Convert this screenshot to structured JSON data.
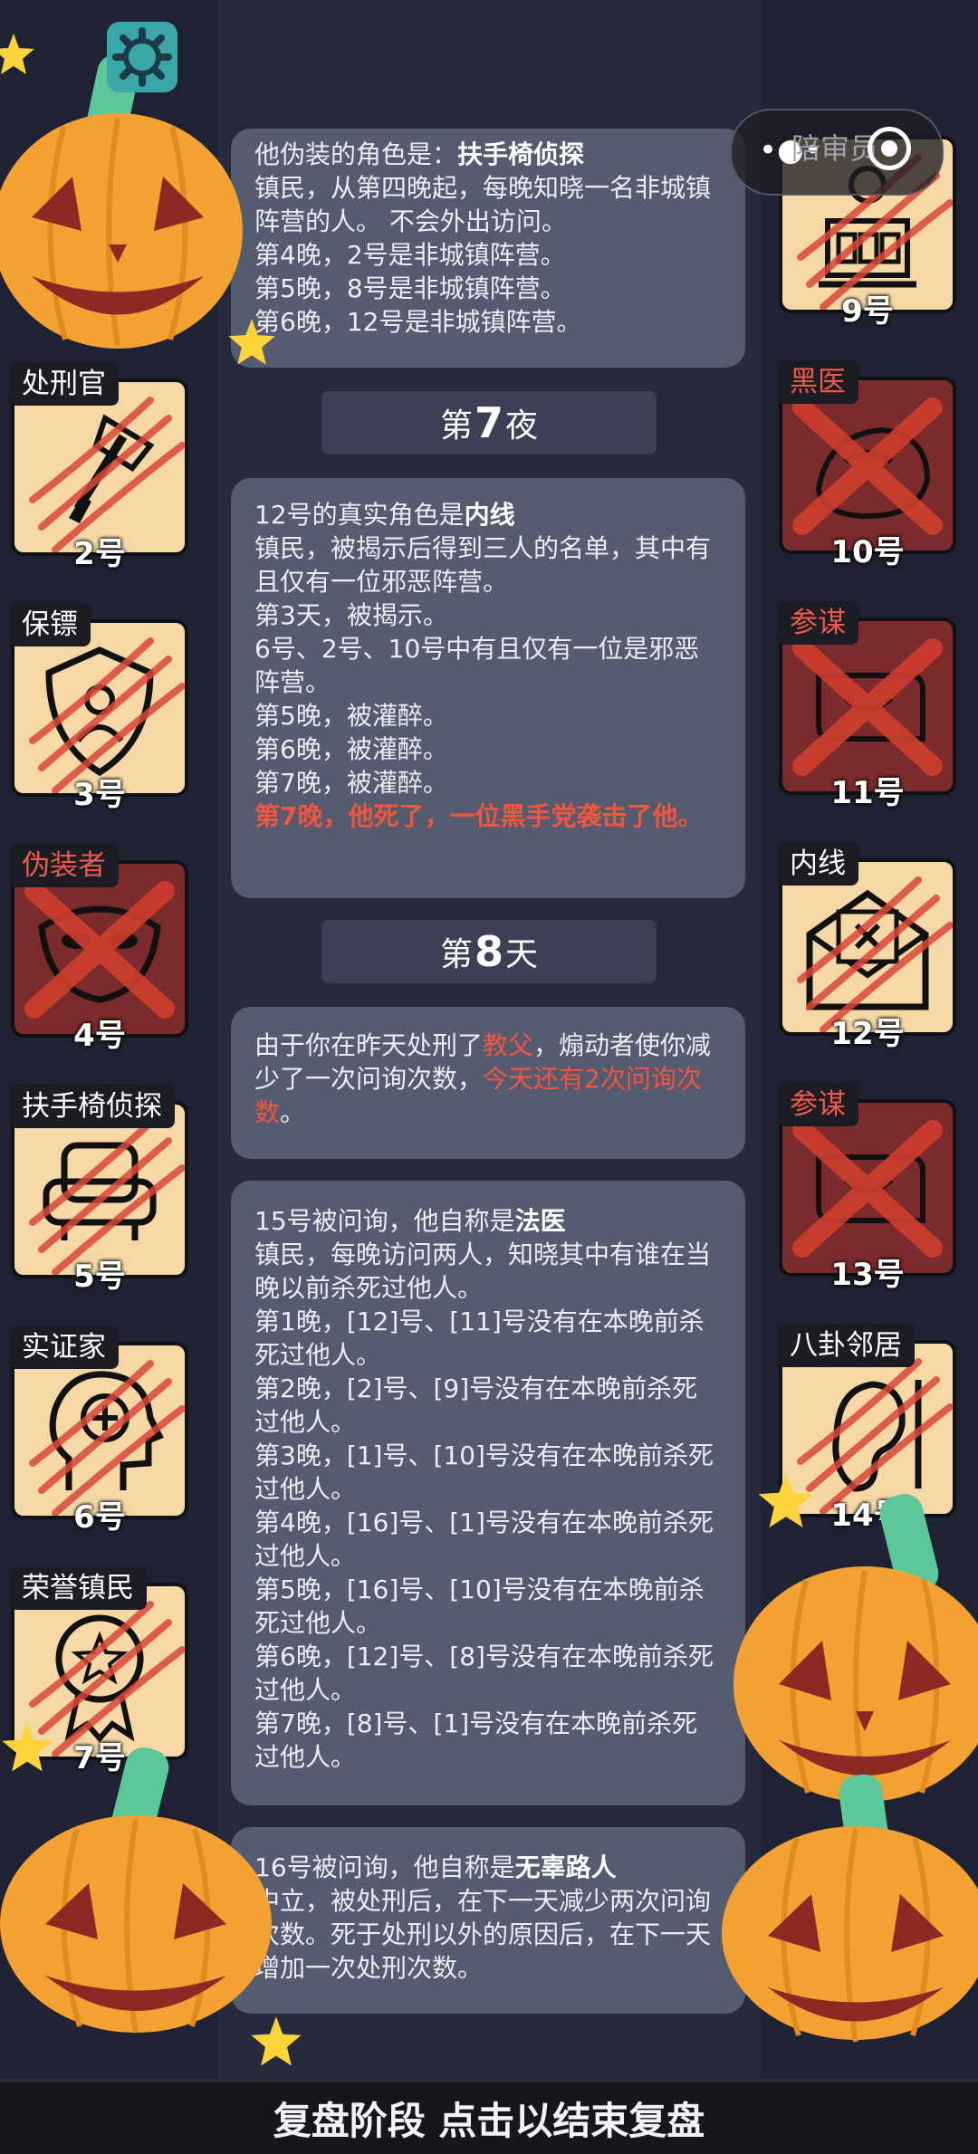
{
  "header": {
    "juror_label": "陪审员"
  },
  "players": [
    {
      "role": "处刑官",
      "number": "2号",
      "icon": "axe-icon",
      "dead": false,
      "role_red": false
    },
    {
      "role": "保镖",
      "number": "3号",
      "icon": "shield-icon",
      "dead": false,
      "role_red": false
    },
    {
      "role": "伪装者",
      "number": "4号",
      "icon": "mask-icon",
      "dead": true,
      "role_red": true
    },
    {
      "role": "扶手椅侦探",
      "number": "5号",
      "icon": "armchair-icon",
      "dead": false,
      "role_red": false
    },
    {
      "role": "实证家",
      "number": "6号",
      "icon": "head-plus-icon",
      "dead": false,
      "role_red": false
    },
    {
      "role": "荣誉镇民",
      "number": "7号",
      "icon": "medal-icon",
      "dead": false,
      "role_red": false
    },
    {
      "role": "",
      "number": "9号",
      "icon": "courthouse-icon",
      "dead": false,
      "role_red": false
    },
    {
      "role": "黑医",
      "number": "10号",
      "icon": "dark-doctor-icon",
      "dead": true,
      "role_red": true
    },
    {
      "role": "参谋",
      "number": "11号",
      "icon": "scroll-icon",
      "dead": true,
      "role_red": true
    },
    {
      "role": "内线",
      "number": "12号",
      "icon": "envelope-icon",
      "dead": false,
      "role_red": false
    },
    {
      "role": "参谋",
      "number": "13号",
      "icon": "scroll-icon",
      "dead": true,
      "role_red": true
    },
    {
      "role": "八卦邻居",
      "number": "14号",
      "icon": "ear-icon",
      "dead": false,
      "role_red": false
    }
  ],
  "log": {
    "block1": {
      "title_prefix": "他伪装的角色是：",
      "title_role": "扶手椅侦探",
      "lines": [
        "镇民，从第四晚起，每晚知晓一名非城镇阵营的人。 不会外出访问。",
        "第4晚，2号是非城镇阵营。",
        "第5晚，8号是非城镇阵营。",
        "第6晚，12号是非城镇阵营。"
      ]
    },
    "night7": {
      "prefix": "第",
      "n": "7",
      "suffix": "夜"
    },
    "block2": {
      "title_prefix": "12号的真实角色是",
      "title_role": "内线",
      "lines": [
        "镇民，被揭示后得到三人的名单，其中有且仅有一位邪恶阵营。",
        "第3天，被揭示。",
        "6号、2号、10号中有且仅有一位是邪恶阵营。",
        "第5晚，被灌醉。",
        "第6晚，被灌醉。",
        "第7晚，被灌醉。"
      ],
      "death": "第7晚，他死了，一位黑手党袭击了他。"
    },
    "day8": {
      "prefix": "第",
      "n": "8",
      "suffix": "天"
    },
    "block3": {
      "part1": "由于你在昨天处刑了",
      "target": "教父",
      "part2": "，煽动者使你减少了一次问询次数，",
      "remaining": "今天还有2次问询次数",
      "part3": "。"
    },
    "block4": {
      "title_prefix": "15号被问询，他自称是",
      "title_role": "法医",
      "lines": [
        "镇民，每晚访问两人，知晓其中有谁在当晚以前杀死过他人。",
        "第1晚，[12]号、[11]号没有在本晚前杀死过他人。",
        "第2晚，[2]号、[9]号没有在本晚前杀死过他人。",
        "第3晚，[1]号、[10]号没有在本晚前杀死过他人。",
        "第4晚，[16]号、[1]号没有在本晚前杀死过他人。",
        "第5晚，[16]号、[10]号没有在本晚前杀死过他人。",
        "第6晚，[12]号、[8]号没有在本晚前杀死过他人。",
        "第7晚，[8]号、[1]号没有在本晚前杀死过他人。"
      ]
    },
    "block5": {
      "title_prefix": "16号被问询，他自称是",
      "title_role": "无辜路人",
      "lines": [
        "中立，被处刑后，在下一天减少两次问询次数。死于处刑以外的原因后，在下一天增加一次处刑次数。"
      ]
    }
  },
  "footer": {
    "label": "复盘阶段 点击以结束复盘"
  },
  "colors": {
    "background": "#1f2233",
    "card_alive": "#f6d8a6",
    "card_dead": "#7b2b2b",
    "highlight": "#f0563e",
    "pumpkin": "#f4a733"
  }
}
